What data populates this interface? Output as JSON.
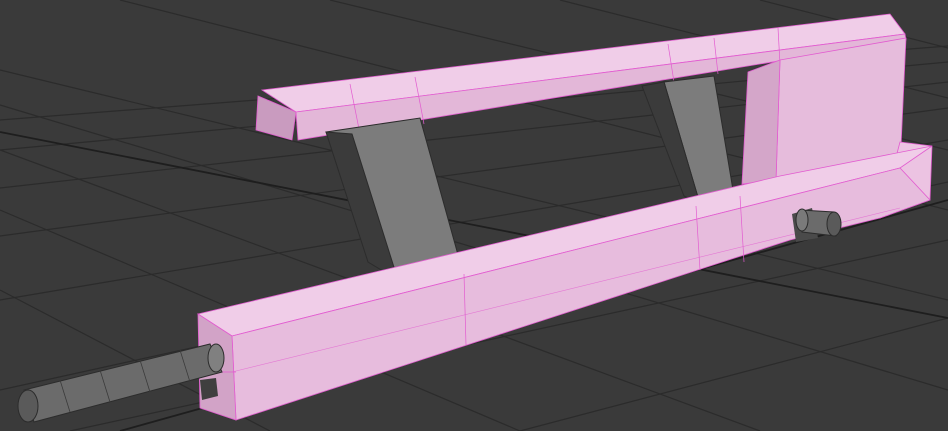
{
  "viewport": {
    "background_color": "#3a3a3a",
    "grid_color": "#2a2a2a",
    "grid_dark_color": "#1d1d1d"
  },
  "model": {
    "selected_face_color": "#ecc3e2",
    "selected_face_shade_color": "#d9acce",
    "selected_face_dark_color": "#c895bc",
    "edge_highlight_color": "#e25cd0",
    "support_color": "#7c7c7c",
    "support_dark_color": "#3b3b3b",
    "cylinder_color": "#6b6b6b",
    "outline_color": "#2c2c2c"
  }
}
